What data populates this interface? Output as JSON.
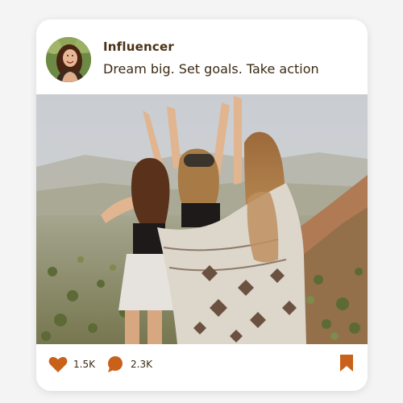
{
  "post": {
    "author": {
      "name": "Influencer",
      "avatar_icon": "avatar-photo"
    },
    "caption": "Dream big. Set goals. Take action",
    "image_icon": "photo-friends-on-mountain",
    "likes": {
      "icon": "heart-icon",
      "count": "1.5K"
    },
    "comments": {
      "icon": "comment-icon",
      "count": "2.3K"
    },
    "bookmark": {
      "icon": "bookmark-icon"
    }
  },
  "colors": {
    "accent": "#c9611b",
    "text_dark": "#3d2a14",
    "name_text": "#4a3216",
    "card_bg": "#ffffff",
    "page_bg": "#f4f4f4"
  }
}
